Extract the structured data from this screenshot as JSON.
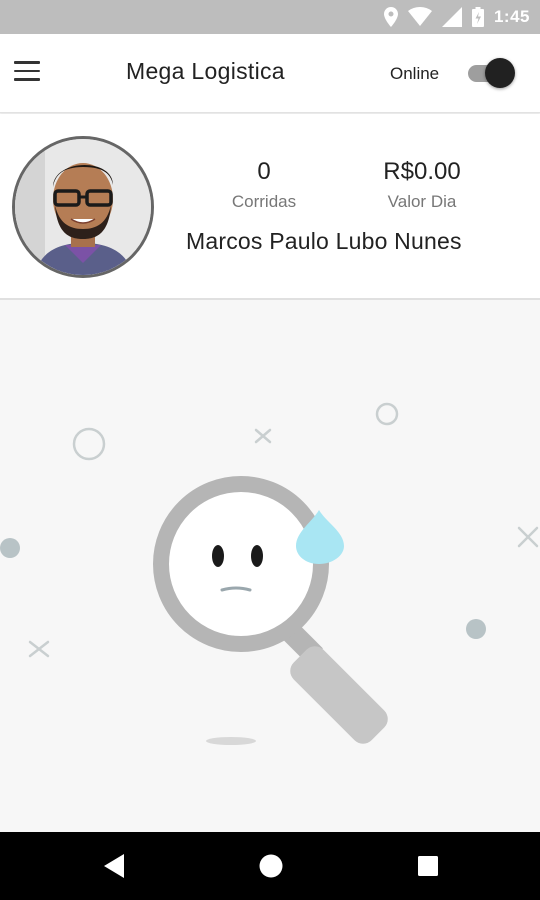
{
  "status_bar": {
    "time": "1:45"
  },
  "app_bar": {
    "title": "Mega Logistica",
    "online_label": "Online",
    "online_enabled": true
  },
  "profile": {
    "rides_count": "0",
    "rides_label": "Corridas",
    "day_value": "R$0.00",
    "day_value_label": "Valor Dia",
    "driver_name": "Marcos Paulo Lubo Nunes"
  },
  "colors": {
    "status_bar_bg": "#bdbdbd",
    "switch_thumb": "#212121",
    "drop_accent": "#a9e6f3",
    "magnifier_gray": "#b5b5b5"
  }
}
